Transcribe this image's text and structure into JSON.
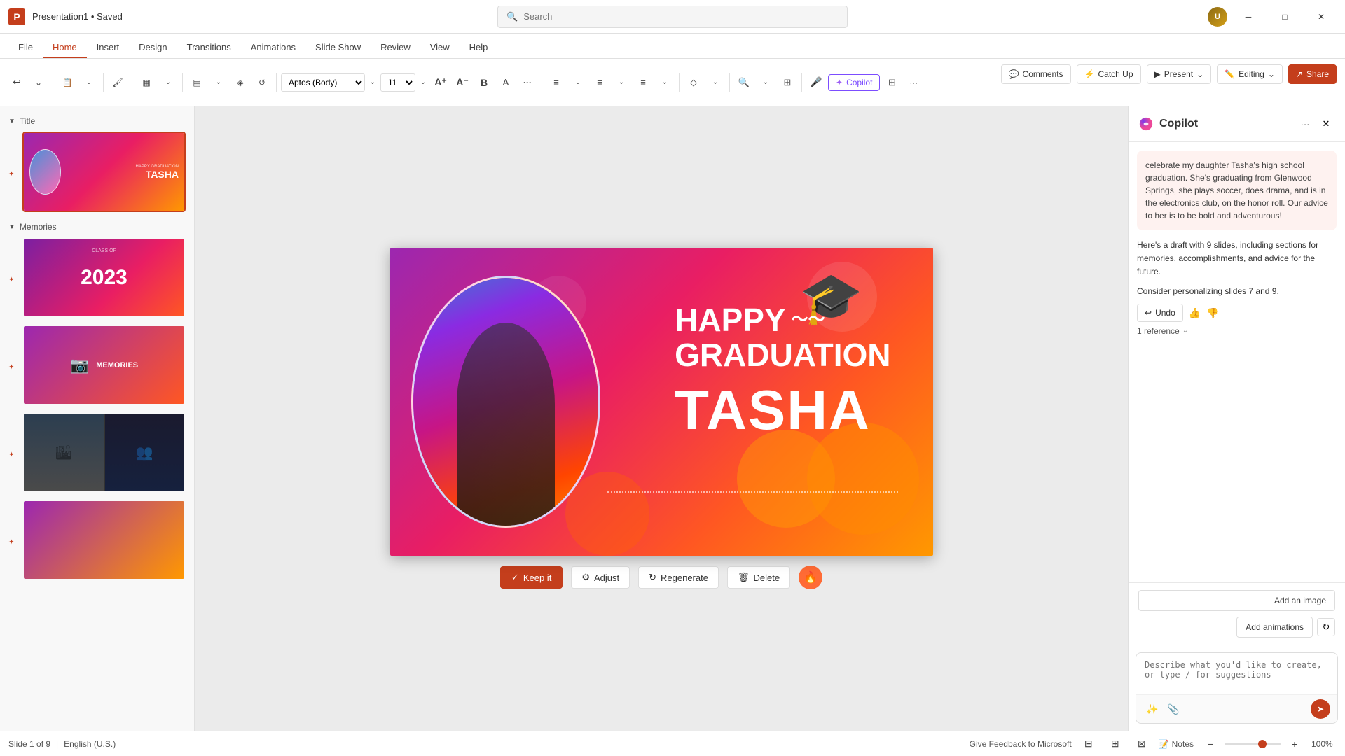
{
  "app": {
    "title": "Presentation1 • Saved",
    "icon": "P"
  },
  "search": {
    "placeholder": "Search"
  },
  "titlebar": {
    "minimize": "─",
    "maximize": "□",
    "close": "✕"
  },
  "ribbon": {
    "tabs": [
      "File",
      "Home",
      "Insert",
      "Design",
      "Transitions",
      "Animations",
      "Slide Show",
      "Review",
      "View",
      "Help"
    ],
    "active_tab": "Home",
    "toolbar": {
      "font_family": "Aptos (Body)",
      "font_size": "11",
      "copilot_label": "Copilot"
    }
  },
  "top_actions": {
    "comments": "Comments",
    "catch_up": "Catch Up",
    "present": "Present",
    "editing": "Editing",
    "share": "Share"
  },
  "slides": {
    "sections": [
      {
        "name": "Title",
        "items": [
          {
            "number": 1,
            "type": "title",
            "active": true
          }
        ]
      },
      {
        "name": "Memories",
        "items": [
          {
            "number": 2,
            "type": "year"
          },
          {
            "number": 3,
            "type": "memories"
          },
          {
            "number": 4,
            "type": "photos"
          },
          {
            "number": 5,
            "type": "group"
          }
        ]
      }
    ],
    "total": "Slide 1 of 9"
  },
  "canvas": {
    "main_text_line1": "HAPPY",
    "main_text_line2": "GRADUATION",
    "name_text": "TASHA",
    "slide2_year": "2023",
    "slide2_class": "CLASS OF",
    "slide3_memories": "MEMORIES"
  },
  "canvas_actions": {
    "keep": "Keep it",
    "adjust": "Adjust",
    "regenerate": "Regenerate",
    "delete": "Delete"
  },
  "copilot": {
    "title": "Copilot",
    "context_message": "celebrate my daughter Tasha's high school graduation. She's graduating from Glenwood Springs, she plays soccer, does drama, and is in the electronics club, on the honor roll. Our advice to her is to be bold and adventurous!",
    "ai_response_1": "Here's a draft with 9 slides, including sections for memories, accomplishments, and advice for the future.",
    "ai_response_2": "Consider personalizing slides 7 and 9.",
    "undo_label": "Undo",
    "reference_label": "1 reference",
    "suggestion_1": "Add an image",
    "suggestion_2": "Add animations",
    "input_placeholder": "Describe what you'd like to create, or type / for suggestions",
    "send_icon": "➤"
  },
  "statusbar": {
    "slide_info": "Slide 1 of 9",
    "language": "English (U.S.)",
    "feedback": "Give Feedback to Microsoft",
    "notes": "Notes",
    "zoom": "100%"
  },
  "icons": {
    "search": "🔍",
    "comments": "💬",
    "catch_up": "⚡",
    "present": "▶",
    "editing": "✏️",
    "share": "↗",
    "undo": "↩",
    "redo": "↪",
    "keep_check": "✓",
    "adjust": "⚙",
    "regenerate": "↻",
    "delete": "🗑",
    "camera": "📷",
    "thumb_up": "👍",
    "thumb_down": "👎",
    "chevron_down": "⌄",
    "more": "···",
    "close": "✕",
    "notes_icon": "📝",
    "star": "✦",
    "send": "➤",
    "sparkle": "✨",
    "paperclip": "📎",
    "copilot_sparkle": "✦"
  }
}
